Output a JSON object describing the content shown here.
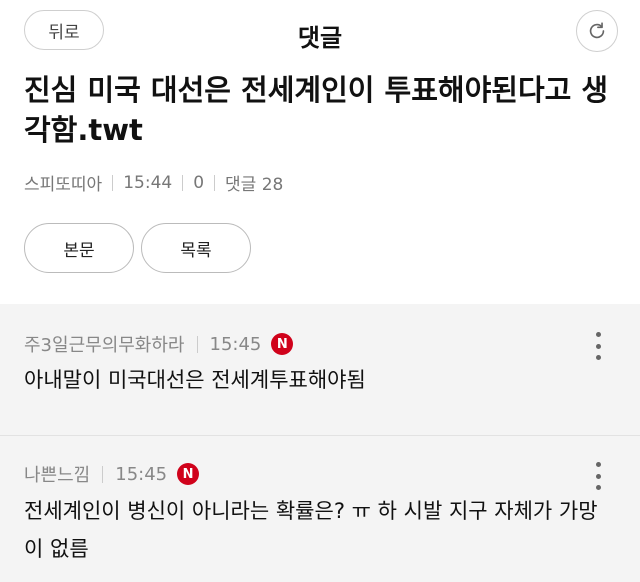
{
  "header": {
    "back_label": "뒤로",
    "title": "댓글",
    "refresh_icon": "refresh-icon"
  },
  "post": {
    "title": "진심 미국 대선은 전세계인이 투표해야된다고 생각함.twt",
    "author": "스피또띠아",
    "time": "15:44",
    "views": "0",
    "comment_count_label": "댓글 28"
  },
  "buttons": {
    "body_label": "본문",
    "list_label": "목록"
  },
  "comments": [
    {
      "author": "주3일근무의무화하라",
      "time": "15:45",
      "badge": "N",
      "text": "아내말이 미국대선은 전세계투표해야됨"
    },
    {
      "author": "나쁜느낌",
      "time": "15:45",
      "badge": "N",
      "text": "전세계인이 병신이 아니라는 확률은? ㅠ 하 시발 지구 자체가 가망이 없름"
    }
  ],
  "colors": {
    "badge_red": "#d0021b",
    "meta_gray": "#888888",
    "comment_bg": "#f4f4f4"
  }
}
